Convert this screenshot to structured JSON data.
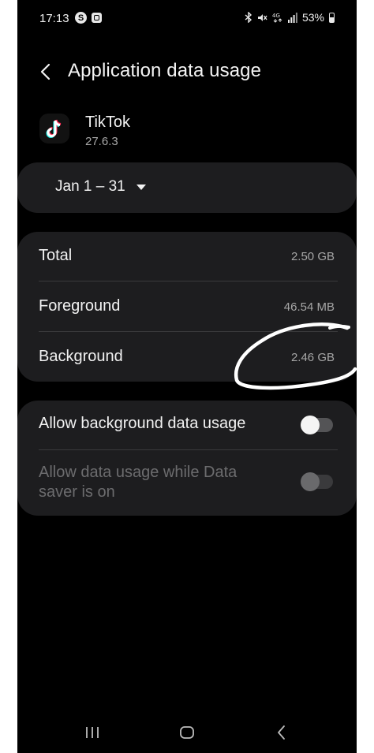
{
  "status_bar": {
    "time": "17:13",
    "left_icons": [
      "s-badge-icon",
      "notification-square-icon"
    ],
    "network": "4G",
    "battery": "53%"
  },
  "header": {
    "title": "Application data usage",
    "back_icon": "chevron-left-icon"
  },
  "app": {
    "name": "TikTok",
    "version": "27.6.3",
    "icon": "tiktok-logo-icon"
  },
  "date_range": {
    "label": "Jan 1 – 31",
    "icon": "dropdown-triangle-icon"
  },
  "usage": [
    {
      "label": "Total",
      "value": "2.50 GB"
    },
    {
      "label": "Foreground",
      "value": "46.54 MB"
    },
    {
      "label": "Background",
      "value": "2.46 GB"
    }
  ],
  "toggles": [
    {
      "label": "Allow background data usage",
      "enabled": true,
      "on": false
    },
    {
      "label": "Allow data usage while Data saver is on",
      "enabled": false,
      "on": false
    }
  ],
  "nav": {
    "icons": [
      "recents-icon",
      "home-icon",
      "back-icon"
    ]
  },
  "colors": {
    "background": "#000000",
    "card": "#1d1d1f",
    "text_primary": "#f2f2f2",
    "text_secondary": "#a6a6a6",
    "text_disabled": "#6c6c6e",
    "annotation": "#ffffff"
  }
}
